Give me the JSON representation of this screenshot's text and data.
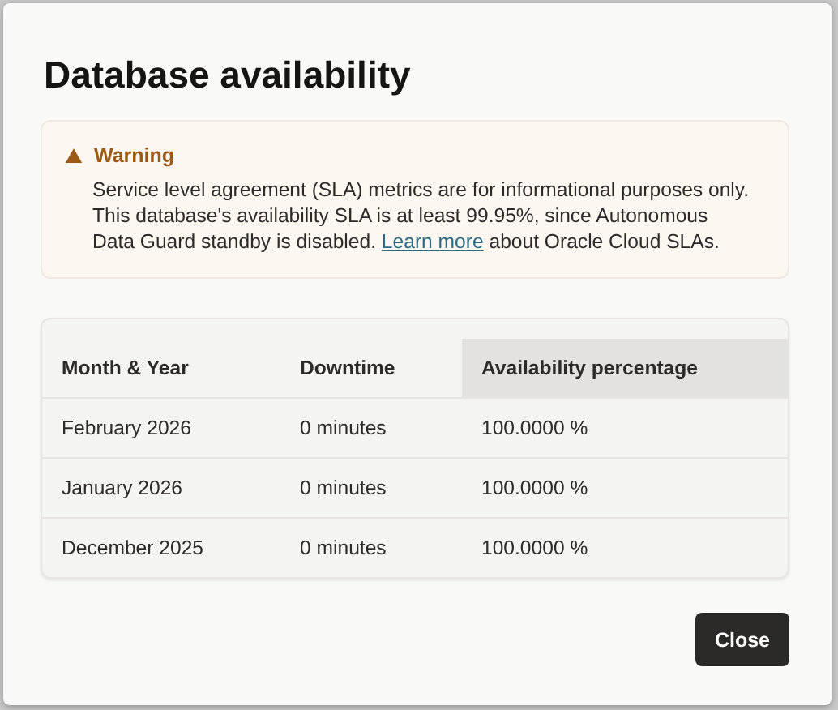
{
  "dialog": {
    "title": "Database availability",
    "warning": {
      "heading": "Warning",
      "text_before": "Service level agreement (SLA) metrics are for informational purposes only. This database's availability SLA is at least 99.95%, since Autonomous Data Guard standby is disabled.",
      "link": "Learn more",
      "text_after": "about Oracle Cloud SLAs."
    },
    "table": {
      "columns": [
        {
          "label": "Month & Year",
          "sorted": false
        },
        {
          "label": "Downtime",
          "sorted": false
        },
        {
          "label": "Availability percentage",
          "sorted": true
        }
      ],
      "rows": [
        [
          "February 2026",
          "0 minutes",
          "100.0000 %"
        ],
        [
          "January 2026",
          "0 minutes",
          "100.0000 %"
        ],
        [
          "December 2025",
          "0 minutes",
          "100.0000 %"
        ]
      ]
    },
    "buttons": [
      "Close"
    ]
  }
}
